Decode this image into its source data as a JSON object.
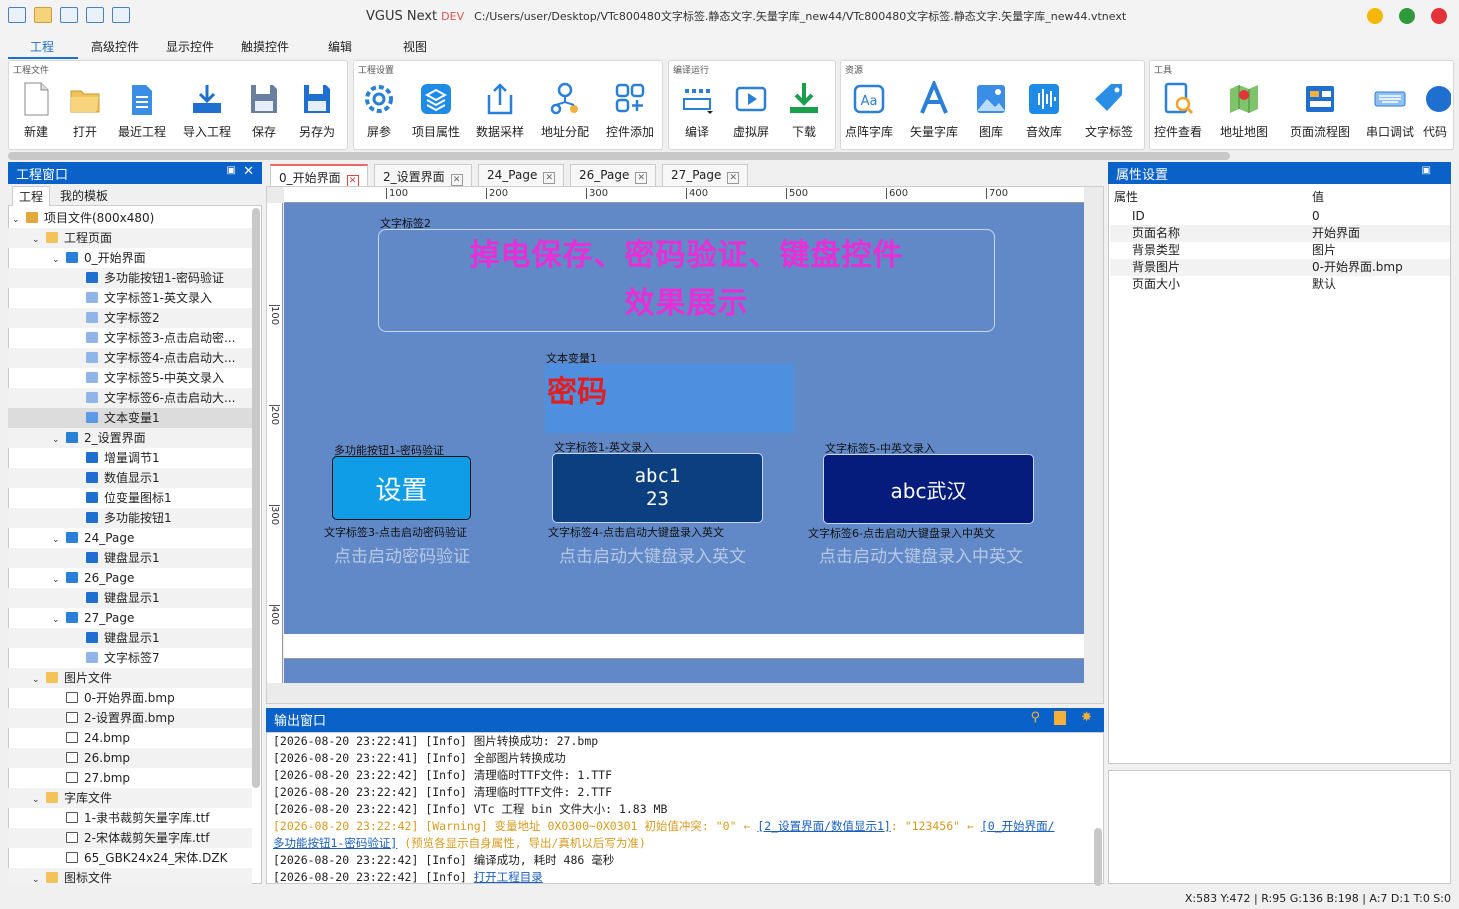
{
  "window": {
    "app_name": "VGUS Next",
    "edition": "DEV",
    "path": "C:/Users/user/Desktop/VTc800480文字标签.静态文字.矢量字库_new44/VTc800480文字标签.静态文字.矢量字库_new44.vtnext",
    "controls": {
      "minimize_color": "#f5b800",
      "maximize_color": "#2f9a3b",
      "close_color": "#e5323a"
    }
  },
  "menu": [
    "工程",
    "高级控件",
    "显示控件",
    "触摸控件",
    "编辑",
    "视图"
  ],
  "ribbon": {
    "groups": [
      {
        "label": "工程文件",
        "buttons": [
          "新建",
          "打开",
          "最近工程",
          "导入工程",
          "保存",
          "另存为"
        ]
      },
      {
        "label": "工程设置",
        "buttons": [
          "屏参",
          "项目属性",
          "数据采样",
          "地址分配",
          "控件添加"
        ]
      },
      {
        "label": "编译运行",
        "buttons": [
          "编译",
          "虚拟屏",
          "下载"
        ]
      },
      {
        "label": "资源",
        "buttons": [
          "点阵字库",
          "矢量字库",
          "图库",
          "音效库",
          "文字标签"
        ]
      },
      {
        "label": "工具",
        "buttons": [
          "控件查看",
          "地址地图",
          "页面流程图",
          "串口调试",
          "代码"
        ]
      }
    ]
  },
  "project_panel": {
    "title": "工程窗口",
    "tabs": [
      "工程",
      "我的模板"
    ],
    "tree": [
      {
        "label": "项目文件(800x480)",
        "level": 0,
        "icon": "project-icon",
        "expanded": true
      },
      {
        "label": "工程页面",
        "level": 1,
        "icon": "folder-icon",
        "expanded": true
      },
      {
        "label": "0_开始界面",
        "level": 2,
        "icon": "page-icon",
        "expanded": true
      },
      {
        "label": "多功能按钮1-密码验证",
        "level": 3,
        "icon": "button-widget-icon"
      },
      {
        "label": "文字标签1-英文录入",
        "level": 3,
        "icon": "text-label-icon"
      },
      {
        "label": "文字标签2",
        "level": 3,
        "icon": "text-label-icon"
      },
      {
        "label": "文字标签3-点击启动密...",
        "level": 3,
        "icon": "text-label-icon"
      },
      {
        "label": "文字标签4-点击启动大...",
        "level": 3,
        "icon": "text-label-icon"
      },
      {
        "label": "文字标签5-中英文录入",
        "level": 3,
        "icon": "text-label-icon"
      },
      {
        "label": "文字标签6-点击启动大...",
        "level": 3,
        "icon": "text-label-icon"
      },
      {
        "label": "文本变量1",
        "level": 3,
        "icon": "text-variable-icon",
        "selected": true
      },
      {
        "label": "2_设置界面",
        "level": 2,
        "icon": "page-icon",
        "expanded": true
      },
      {
        "label": "增量调节1",
        "level": 3,
        "icon": "increment-icon"
      },
      {
        "label": "数值显示1",
        "level": 3,
        "icon": "number-display-icon"
      },
      {
        "label": "位变量图标1",
        "level": 3,
        "icon": "bit-icon"
      },
      {
        "label": "多功能按钮1",
        "level": 3,
        "icon": "button-widget-icon"
      },
      {
        "label": "24_Page",
        "level": 2,
        "icon": "page-icon",
        "expanded": true
      },
      {
        "label": "键盘显示1",
        "level": 3,
        "icon": "keyboard-icon"
      },
      {
        "label": "26_Page",
        "level": 2,
        "icon": "page-icon",
        "expanded": true
      },
      {
        "label": "键盘显示1",
        "level": 3,
        "icon": "keyboard-icon"
      },
      {
        "label": "27_Page",
        "level": 2,
        "icon": "page-icon",
        "expanded": true
      },
      {
        "label": "键盘显示1",
        "level": 3,
        "icon": "keyboard-icon"
      },
      {
        "label": "文字标签7",
        "level": 3,
        "icon": "text-label-icon"
      },
      {
        "label": "图片文件",
        "level": 1,
        "icon": "folder-icon",
        "expanded": true
      },
      {
        "label": "0-开始界面.bmp",
        "level": 2,
        "icon": "file-icon"
      },
      {
        "label": "2-设置界面.bmp",
        "level": 2,
        "icon": "file-icon"
      },
      {
        "label": "24.bmp",
        "level": 2,
        "icon": "file-icon"
      },
      {
        "label": "26.bmp",
        "level": 2,
        "icon": "file-icon"
      },
      {
        "label": "27.bmp",
        "level": 2,
        "icon": "file-icon"
      },
      {
        "label": "字库文件",
        "level": 1,
        "icon": "folder-icon",
        "expanded": true
      },
      {
        "label": "1-隶书裁剪矢量字库.ttf",
        "level": 2,
        "icon": "font-file-icon"
      },
      {
        "label": "2-宋体裁剪矢量字库.ttf",
        "level": 2,
        "icon": "font-file-icon"
      },
      {
        "label": "65_GBK24x24_宋体.DZK",
        "level": 2,
        "icon": "font-file-icon"
      },
      {
        "label": "图标文件",
        "level": 1,
        "icon": "folder-icon",
        "expanded": true
      }
    ]
  },
  "doc_tabs": [
    "0_开始界面",
    "2_设置界面",
    "24_Page",
    "26_Page",
    "27_Page"
  ],
  "ruler": {
    "top": [
      "100",
      "200",
      "300",
      "400",
      "500",
      "600",
      "700"
    ],
    "left": [
      "100",
      "200",
      "300",
      "400"
    ]
  },
  "canvas": {
    "bg_color": "#6189c8",
    "title_label": "文字标签2",
    "title_lines": [
      "掉电保存、密码验证、键盘控件",
      "效果展示"
    ],
    "var_label": "文本变量1",
    "var_text": "密码",
    "btn1": {
      "label": "多功能按钮1-密码验证",
      "text": "设置",
      "hint_label": "文字标签3-点击启动密码验证",
      "hint": "点击启动密码验证"
    },
    "btn2": {
      "label": "文字标签1-英文录入",
      "line1": "abc1",
      "line2": "23",
      "hint_label": "文字标签4-点击启动大键盘录入英文",
      "hint": "点击启动大键盘录入英文"
    },
    "btn3": {
      "label": "文字标签5-中英文录入",
      "text": "abc武汉",
      "hint_label": "文字标签6-点击启动大键盘录入中英文",
      "hint": "点击启动大键盘录入中英文"
    }
  },
  "output": {
    "title": "输出窗口",
    "lines": [
      "[2026-08-20 23:22:41] [Info] 图片转换成功: 27.bmp",
      "[2026-08-20 23:22:41] [Info] 全部图片转换成功",
      "[2026-08-20 23:22:42] [Info] 清理临时TTF文件: 1.TTF",
      "[2026-08-20 23:22:42] [Info] 清理临时TTF文件: 2.TTF",
      "[2026-08-20 23:22:42] [Info] VTc 工程 bin 文件大小: 1.83 MB"
    ],
    "warn1": "[2026-08-20 23:22:42] [Warning] 变量地址 0X0300~0X0301 初始值冲突: \"0\" ← ",
    "warn_link1": "[2_设置界面/数值显示1]",
    "warn_mid": ": \"123456\" ← ",
    "warn_link2": "[0_开始界面/",
    "warn_link3": "多功能按钮1-密码验证]",
    "warn2": " (预览各显示自身属性, 导出/真机以后写为准)",
    "line_compile": "[2026-08-20 23:22:42] [Info] 编译成功, 耗时 486 毫秒",
    "line_last_prefix": "[2026-08-20 23:22:42] [Info] ",
    "line_last_link": "打开工程目录"
  },
  "properties": {
    "title": "属性设置",
    "header_key": "属性",
    "header_value": "值",
    "rows": [
      {
        "key": "ID",
        "value": "0"
      },
      {
        "key": "页面名称",
        "value": "开始界面"
      },
      {
        "key": "背景类型",
        "value": "图片"
      },
      {
        "key": "背景图片",
        "value": "0-开始界面.bmp"
      },
      {
        "key": "页面大小",
        "value": "默认"
      }
    ]
  },
  "status": "X:583  Y:472  |  R:95 G:136 B:198  |  A:7  D:1  T:0  S:0"
}
